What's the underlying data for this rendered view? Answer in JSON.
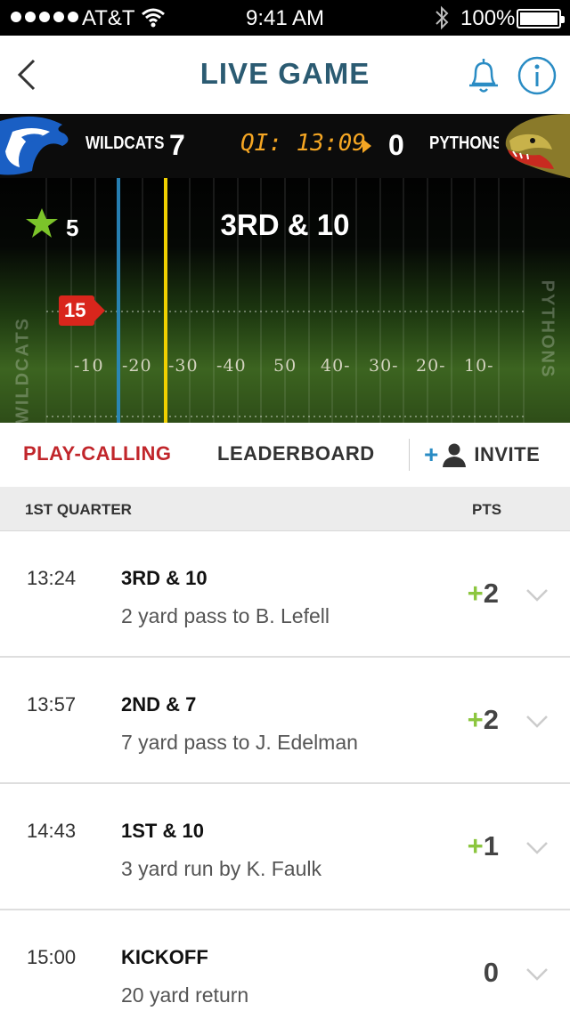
{
  "status_bar": {
    "carrier": "AT&T",
    "time": "9:41 AM",
    "battery": "100%"
  },
  "nav": {
    "title": "LIVE GAME"
  },
  "scoreboard": {
    "home_team": "WILDCATS",
    "home_score": "7",
    "clock": "QI: 13:09",
    "away_score": "0",
    "away_team": "PYTHONS"
  },
  "field": {
    "stars": "5",
    "down_distance": "3RD & 10",
    "ball_marker": "15",
    "endzone_left": "WILDCATS",
    "endzone_right": "PYTHONS",
    "yard_labels": [
      "-10",
      "-20",
      "-30",
      "-40",
      "50",
      "40-",
      "30-",
      "20-",
      "10-"
    ]
  },
  "tabs": {
    "play_calling": "PLAY-CALLING",
    "leaderboard": "LEADERBOARD",
    "invite": "INVITE"
  },
  "section": {
    "quarter": "1ST QUARTER",
    "pts_header": "PTS"
  },
  "plays": [
    {
      "time": "13:24",
      "down": "3RD & 10",
      "desc": "2 yard pass to B. Lefell",
      "sign": "+",
      "points": "2"
    },
    {
      "time": "13:57",
      "down": "2ND & 7",
      "desc": "7 yard pass to J. Edelman",
      "sign": "+",
      "points": "2"
    },
    {
      "time": "14:43",
      "down": "1ST & 10",
      "desc": "3 yard run by K. Faulk",
      "sign": "+",
      "points": "1"
    },
    {
      "time": "15:00",
      "down": "KICKOFF",
      "desc": "20 yard return",
      "sign": "",
      "points": "0"
    }
  ],
  "colors": {
    "title": "#2b5b72",
    "active_tab": "#c1262b",
    "clock": "#f5a623",
    "positive_points": "#8cc63f",
    "accent_blue": "#2a8cc4"
  },
  "icons": {
    "back": "chevron-left-icon",
    "bell": "bell-icon",
    "info": "info-icon",
    "star": "star-icon",
    "add_user": "add-user-icon",
    "expand": "chevron-down-icon"
  }
}
